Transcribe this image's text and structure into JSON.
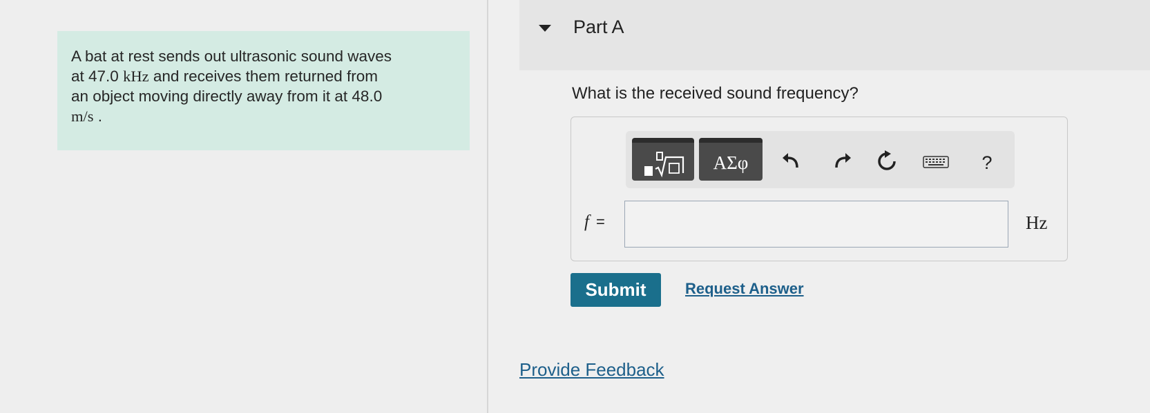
{
  "problem": {
    "line1": "A bat at rest sends out ultrasonic sound waves",
    "line2_prefix": "at 47.0",
    "line2_unit": "kHz",
    "line2_suffix": "and receives them returned from",
    "line3": "an object moving directly away from it at 48.0",
    "line4_unit": "m/s",
    "line4_suffix": "."
  },
  "part": {
    "title": "Part A",
    "question": "What is the received sound frequency?"
  },
  "toolbar": {
    "greek_label": "ΑΣφ",
    "undo_icon": "undo-icon",
    "redo_icon": "redo-icon",
    "reset_icon": "reset-icon",
    "keyboard_icon": "keyboard-icon",
    "help_label": "?"
  },
  "answer": {
    "variable": "f",
    "equals": "=",
    "value": "",
    "placeholder": "",
    "unit": "Hz"
  },
  "actions": {
    "submit_label": "Submit",
    "request_answer_label": "Request Answer",
    "feedback_label": "Provide Feedback"
  },
  "colors": {
    "problem_bg": "#d4ebe3",
    "submit_bg": "#1a6f8c",
    "link": "#1d5f8a",
    "template_button_bg": "#4a4a4a"
  }
}
